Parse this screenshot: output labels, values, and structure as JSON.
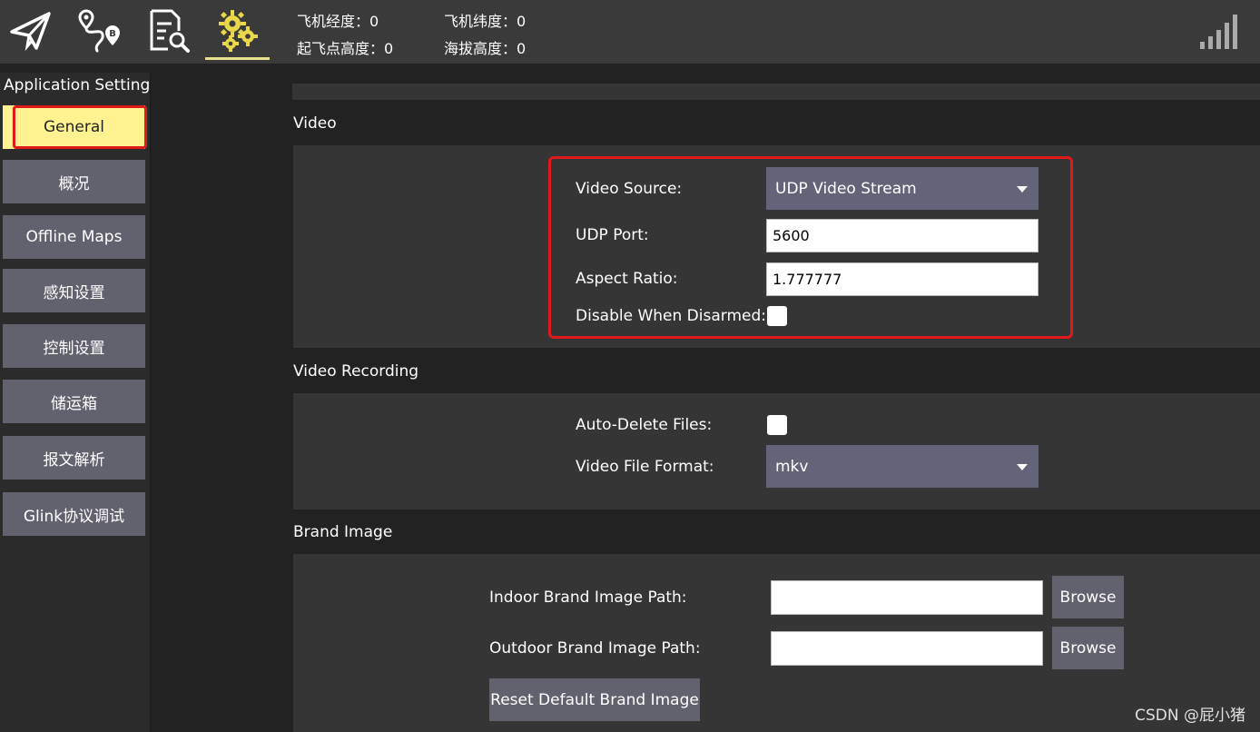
{
  "toolbar": {
    "icons": [
      "paper-plane-icon",
      "route-plan-icon",
      "analyze-icon",
      "settings-gears-icon"
    ],
    "telemetry": {
      "lon": "飞机经度：0",
      "lat": "飞机纬度：0",
      "takeoff_alt": "起飞点高度：0",
      "msl_alt": "海拔高度：0"
    },
    "signal_icon": "signal-strength-icon"
  },
  "sidebar": {
    "title": "Application Settings",
    "items": [
      {
        "label": "General"
      },
      {
        "label": "概况"
      },
      {
        "label": "Offline Maps"
      },
      {
        "label": "感知设置"
      },
      {
        "label": "控制设置"
      },
      {
        "label": "储运箱"
      },
      {
        "label": "报文解析"
      },
      {
        "label": "Glink协议调试"
      }
    ]
  },
  "video": {
    "title": "Video",
    "source_label": "Video Source:",
    "source_value": "UDP Video Stream",
    "port_label": "UDP Port:",
    "port_value": "5600",
    "aspect_label": "Aspect Ratio:",
    "aspect_value": "1.777777",
    "disable_label": "Disable When Disarmed:",
    "disable_checked": false
  },
  "recording": {
    "title": "Video Recording",
    "auto_delete_label": "Auto-Delete Files:",
    "auto_delete_checked": false,
    "format_label": "Video File Format:",
    "format_value": "mkv"
  },
  "brand": {
    "title": "Brand Image",
    "indoor_label": "Indoor Brand Image Path:",
    "indoor_value": "",
    "outdoor_label": "Outdoor Brand Image Path:",
    "outdoor_value": "",
    "browse_label": "Browse",
    "reset_label": "Reset Default Brand Image"
  },
  "watermark": "CSDN @屁小猪",
  "colors": {
    "accent_yellow": "#fff291",
    "highlight_red": "#e0191b",
    "button_gray": "#62626e",
    "panel": "#353535"
  }
}
